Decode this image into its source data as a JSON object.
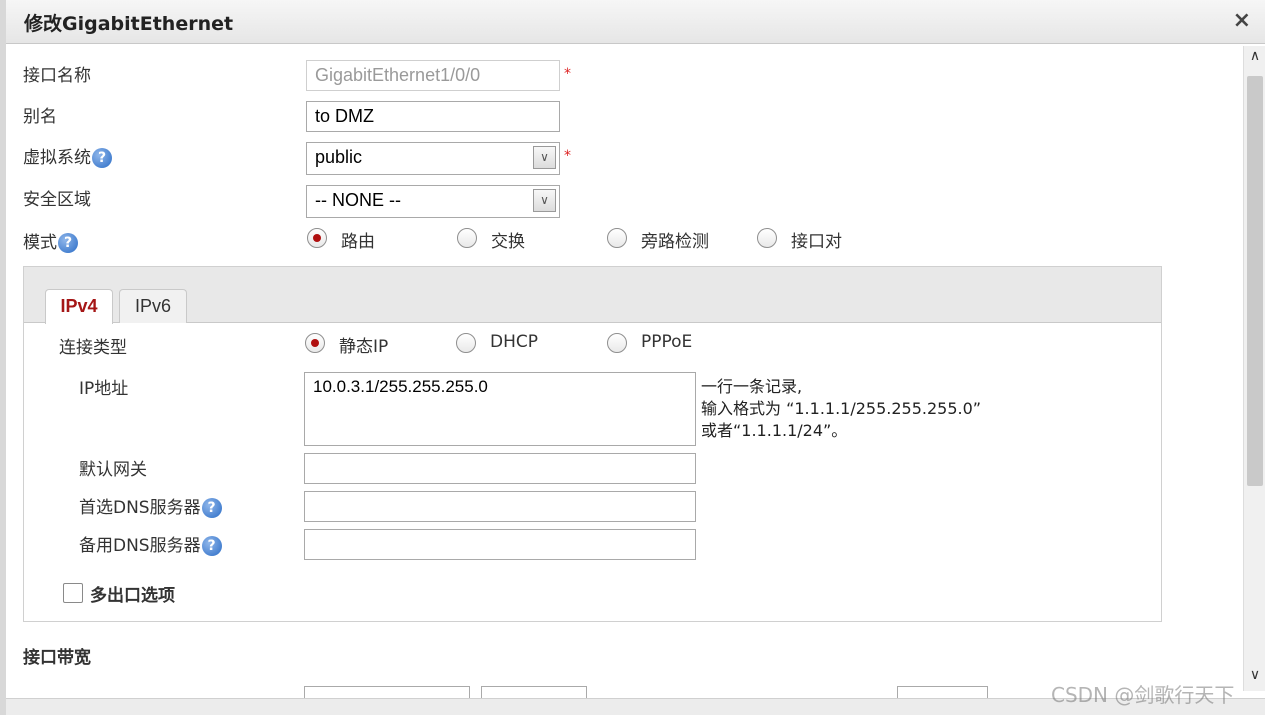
{
  "dialog": {
    "title": "修改GigabitEthernet",
    "close_glyph": "×"
  },
  "form": {
    "interface_name": {
      "label": "接口名称",
      "value": "GigabitEthernet1/0/0",
      "required": "*"
    },
    "alias": {
      "label": "别名",
      "value": "to DMZ"
    },
    "virtual_system": {
      "label": "虚拟系统",
      "value": "public",
      "required": "*"
    },
    "security_zone": {
      "label": "安全区域",
      "value": "-- NONE --"
    },
    "mode": {
      "label": "模式",
      "options": [
        "路由",
        "交换",
        "旁路检测",
        "接口对"
      ],
      "selected": "路由"
    }
  },
  "tabs": [
    {
      "label": "IPv4",
      "active": true
    },
    {
      "label": "IPv6",
      "active": false
    }
  ],
  "ipv4": {
    "connection_type": {
      "label": "连接类型",
      "options": [
        "静态IP",
        "DHCP",
        "PPPoE"
      ],
      "selected": "静态IP"
    },
    "ip_address": {
      "label": "IP地址",
      "value": "10.0.3.1/255.255.255.0"
    },
    "hint": {
      "line1": "一行一条记录,",
      "line2": "输入格式为 “1.1.1.1/255.255.255.0”",
      "line3": "或者“1.1.1.1/24”。"
    },
    "default_gateway": {
      "label": "默认网关",
      "value": ""
    },
    "primary_dns": {
      "label": "首选DNS服务器",
      "value": ""
    },
    "secondary_dns": {
      "label": "备用DNS服务器",
      "value": ""
    },
    "multi_egress": {
      "label": "多出口选项",
      "checked": false
    }
  },
  "bandwidth": {
    "section_label": "接口带宽"
  },
  "icons": {
    "help": "?",
    "dropdown": "∨",
    "scroll_up": "∧",
    "scroll_down": "∨"
  },
  "watermark": "CSDN @剑歌行天下",
  "colors": {
    "accent": "#a51616",
    "help_blue": "#2a6cc6"
  }
}
